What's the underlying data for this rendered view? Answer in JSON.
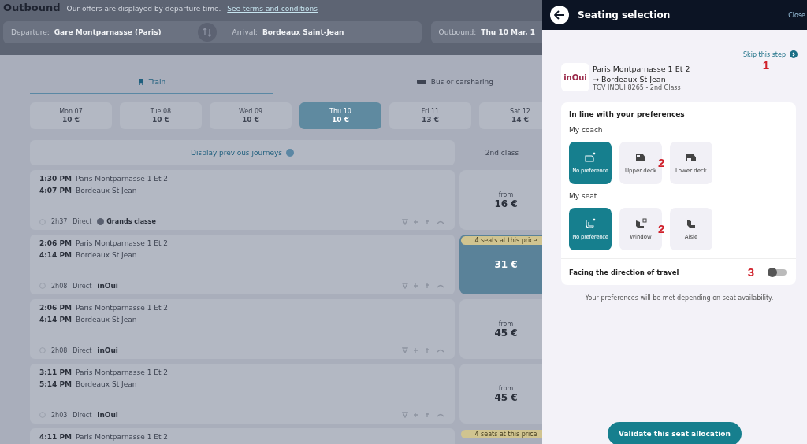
{
  "page": {
    "title": "Outbound",
    "subtitle": "Our offers are displayed by departure time.",
    "subtitle_link": "See terms and conditions",
    "search": [
      {
        "label": "Departure:",
        "value": "Gare Montparnasse (Paris)"
      },
      {
        "label": "Arrival:",
        "value": "Bordeaux Saint-Jean"
      },
      {
        "label": "Outbound:",
        "value": "Thu 10 Mar, 1"
      }
    ],
    "modes": [
      {
        "label": "Train",
        "selected": true
      },
      {
        "label": "Bus or carsharing",
        "selected": false
      }
    ],
    "dates": [
      {
        "day": "Mon 07",
        "price": "10 €",
        "selected": false
      },
      {
        "day": "Tue 08",
        "price": "10 €",
        "selected": false
      },
      {
        "day": "Wed 09",
        "price": "10 €",
        "selected": false
      },
      {
        "day": "Thu 10",
        "price": "10 €",
        "selected": true
      },
      {
        "day": "Fri 11",
        "price": "13 €",
        "selected": false
      },
      {
        "day": "Sat 12",
        "price": "14 €",
        "selected": false
      }
    ],
    "previous": "Display previous journeys",
    "class_header": "2nd class",
    "journeys": [
      {
        "dep": "1:30 PM",
        "from": "Paris Montparnasse 1 Et 2",
        "arr": "4:07 PM",
        "to": "Bordeaux St Jean",
        "duration": "2h37",
        "type": "Direct",
        "brand": "Grands classe",
        "kind": "badge",
        "from_label": "from",
        "price": "16 €",
        "selected": false
      },
      {
        "dep": "2:06 PM",
        "from": "Paris Montparnasse 1 Et 2",
        "arr": "4:14 PM",
        "to": "Bordeaux St Jean",
        "duration": "2h08",
        "type": "Direct",
        "brand": "inOui",
        "kind": "logo",
        "price": "31 €",
        "badge": "4 seats at this price",
        "selected": true
      },
      {
        "dep": "2:06 PM",
        "from": "Paris Montparnasse 1 Et 2",
        "arr": "4:14 PM",
        "to": "Bordeaux St Jean",
        "duration": "2h08",
        "type": "Direct",
        "brand": "inOui",
        "kind": "logo",
        "from_label": "from",
        "price": "45 €",
        "selected": false
      },
      {
        "dep": "3:11 PM",
        "from": "Paris Montparnasse 1 Et 2",
        "arr": "5:14 PM",
        "to": "Bordeaux St Jean",
        "duration": "2h03",
        "type": "Direct",
        "brand": "inOui",
        "kind": "logo",
        "from_label": "from",
        "price": "45 €",
        "selected": false
      },
      {
        "dep": "4:11 PM",
        "from": "Paris Montparnasse 1 Et 2",
        "badge": "4 seats at this price",
        "selected": false
      }
    ]
  },
  "panel": {
    "title": "Seating selection",
    "close": "Close",
    "skip": "Skip this step",
    "skip_annotation": "1",
    "train": {
      "logo": "inOui",
      "from": "Paris Montparnasse 1 Et 2",
      "to": "→ Bordeaux St Jean",
      "info": "TGV INOUI 8265 - 2nd Class"
    },
    "heading": "In line with your preferences",
    "groups": [
      {
        "label": "My coach",
        "annotation": "2",
        "options": [
          {
            "label": "No preference",
            "selected": true
          },
          {
            "label": "Upper deck",
            "selected": false
          },
          {
            "label": "Lower deck",
            "selected": false
          }
        ]
      },
      {
        "label": "My seat",
        "annotation": "2",
        "options": [
          {
            "label": "No preference",
            "selected": true
          },
          {
            "label": "Window",
            "selected": false
          },
          {
            "label": "Aisle",
            "selected": false
          }
        ]
      }
    ],
    "facing": {
      "label": "Facing the direction of travel",
      "on": false,
      "annotation": "3"
    },
    "note": "Your preferences will be met depending on seat availability.",
    "validate": "Validate this seat allocation"
  }
}
